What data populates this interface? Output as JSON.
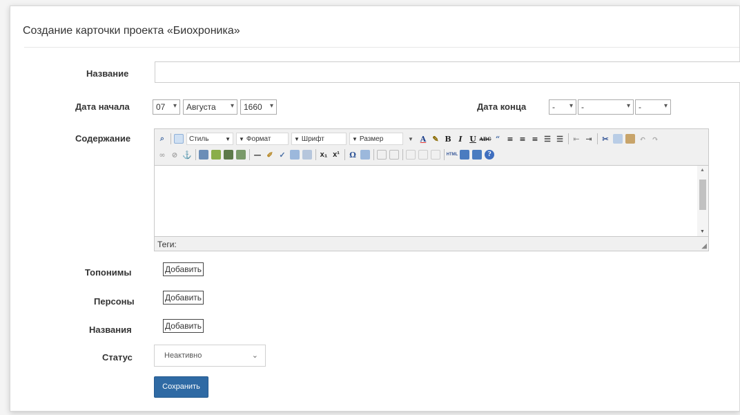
{
  "page": {
    "title": "Создание карточки проекта «Биохроника»"
  },
  "form": {
    "name_label": "Название",
    "name_value": "",
    "start_label": "Дата начала",
    "start_day": "07",
    "start_month": "Августа",
    "start_year": "1660",
    "end_label": "Дата конца",
    "end_day": "-",
    "end_month": "-",
    "end_year": "-",
    "content_label": "Содержание",
    "toponyms_label": "Топонимы",
    "persons_label": "Персоны",
    "titles_label": "Названия",
    "add_label": "Добавить",
    "status_label": "Статус",
    "status_value": "Неактивно",
    "save_label": "Сохранить"
  },
  "editor": {
    "style_combo": "Стиль",
    "format_combo": "Формат",
    "font_combo": "Шрифт",
    "size_combo": "Размер",
    "tags_label": "Теги:",
    "toolbar_row1_icons": [
      "preview-icon",
      "templates-icon",
      "text-color-icon",
      "bg-color-icon",
      "bold-icon",
      "italic-icon",
      "underline-icon",
      "strike-icon",
      "quote-icon",
      "align-left-icon",
      "align-center-icon",
      "align-right-icon",
      "bullet-list-icon",
      "numbered-list-icon",
      "outdent-icon",
      "indent-icon",
      "cut-icon",
      "copy-icon",
      "paste-icon",
      "undo-icon",
      "redo-icon"
    ],
    "toolbar_row2_icons": [
      "link-icon",
      "unlink-icon",
      "anchor-icon",
      "image-icon",
      "flash-icon",
      "media-icon",
      "table-icon",
      "hr-icon",
      "eraser-icon",
      "spell-icon",
      "find-icon",
      "select-all-icon",
      "subscript-icon",
      "superscript-icon",
      "special-char-icon",
      "edit-icon",
      "row-icon",
      "column-icon",
      "cell-icon",
      "merge-icon",
      "split-icon",
      "html-icon",
      "source-icon",
      "fullscreen-icon",
      "help-icon"
    ]
  }
}
